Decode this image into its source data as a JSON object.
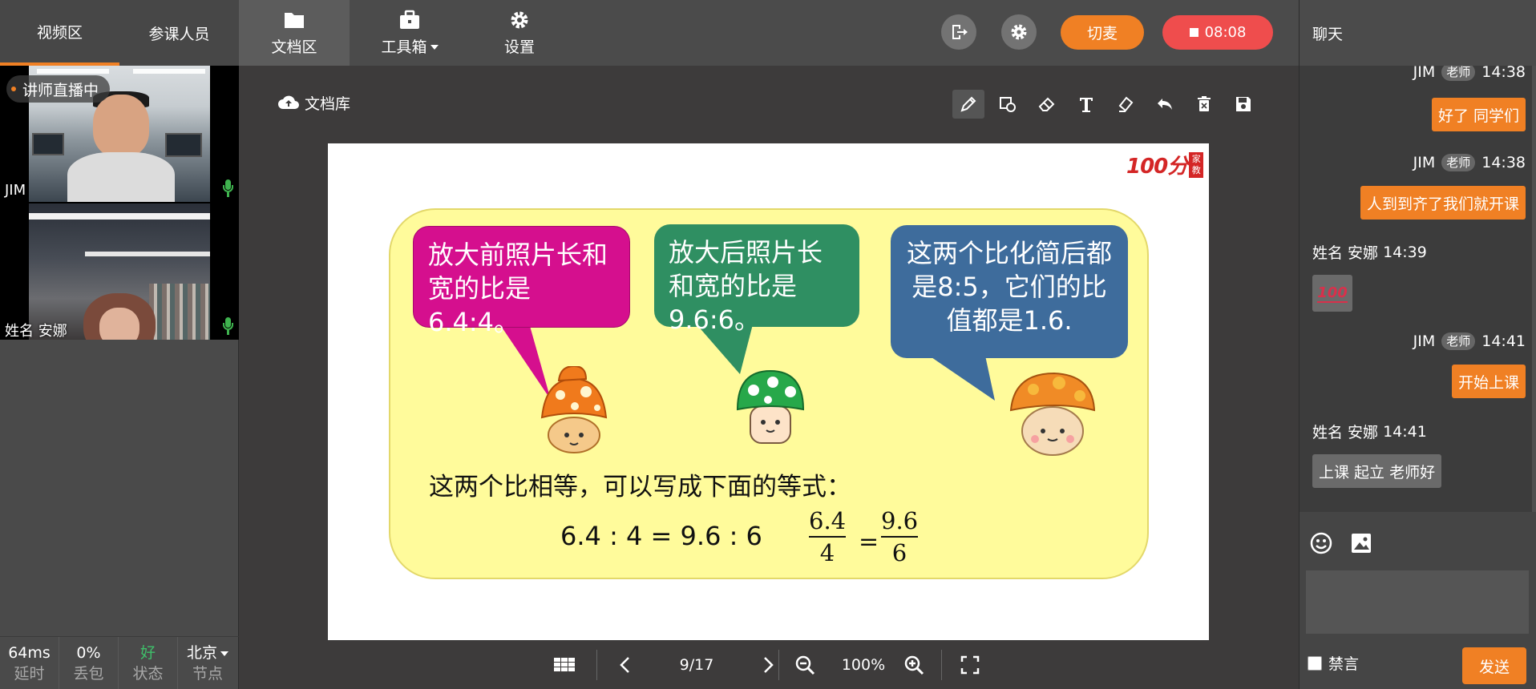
{
  "left": {
    "tabs": [
      "视频区",
      "参课人员"
    ],
    "live_badge": "讲师直播中",
    "videos": [
      {
        "name": "JIM"
      },
      {
        "name": "姓名 安娜"
      }
    ],
    "stats": [
      {
        "value": "64ms",
        "label": "延时"
      },
      {
        "value": "0%",
        "label": "丢包"
      },
      {
        "value": "好",
        "label": "状态"
      },
      {
        "value": "北京",
        "label": "节点"
      }
    ]
  },
  "topbar": {
    "nav": [
      {
        "label": "文档区",
        "icon": "folder-icon"
      },
      {
        "label": "工具箱",
        "icon": "briefcase-icon"
      },
      {
        "label": "设置",
        "icon": "gear-icon"
      }
    ],
    "switch_mic": "切麦",
    "timer": "08:08"
  },
  "doc": {
    "library_label": "文档库",
    "tools": [
      "pencil-icon",
      "shapes-icon",
      "eraser-icon",
      "text-icon",
      "clear-icon",
      "undo-icon",
      "trash-icon",
      "save-icon"
    ],
    "brand_number": "100分",
    "brand_tag": "家教",
    "bubble1": "放大前照片长和宽的比是6.4:4。",
    "bubble2": "放大后照片长和宽的比是9.6:6。",
    "bubble3": "这两个比化简后都是8:5，它们的比值都是1.6.",
    "statement": "这两个比相等，可以写成下面的等式：",
    "equation": "6.4 : 4 = 9.6 : 6",
    "frac1": {
      "num": "6.4",
      "den": "4"
    },
    "equals": "=",
    "frac2": {
      "num": "9.6",
      "den": "6"
    },
    "colors": {
      "bubble1": "#d50f8e",
      "bubble2": "#2f8f62",
      "bubble3": "#3e6c9c",
      "box": "#fffb9b"
    }
  },
  "bottom": {
    "page": "9/17",
    "zoom": "100%"
  },
  "chat": {
    "title": "聊天",
    "messages": [
      {
        "sender": "JIM",
        "role": "老师",
        "time": "14:38",
        "text": "好了 同学们"
      },
      {
        "sender": "JIM",
        "role": "老师",
        "time": "14:38",
        "text": "人到到齐了我们就开课"
      },
      {
        "sender": "姓名 安娜",
        "time": "14:39",
        "text": "💯"
      },
      {
        "sender": "JIM",
        "role": "老师",
        "time": "14:41",
        "text": "开始上课"
      },
      {
        "sender": "姓名 安娜",
        "time": "14:41",
        "text": "上课 起立 老师好"
      }
    ],
    "emoji_text": "100",
    "mute_label": "禁言",
    "send_label": "发送",
    "input_value": ""
  },
  "accent": "#f08024"
}
